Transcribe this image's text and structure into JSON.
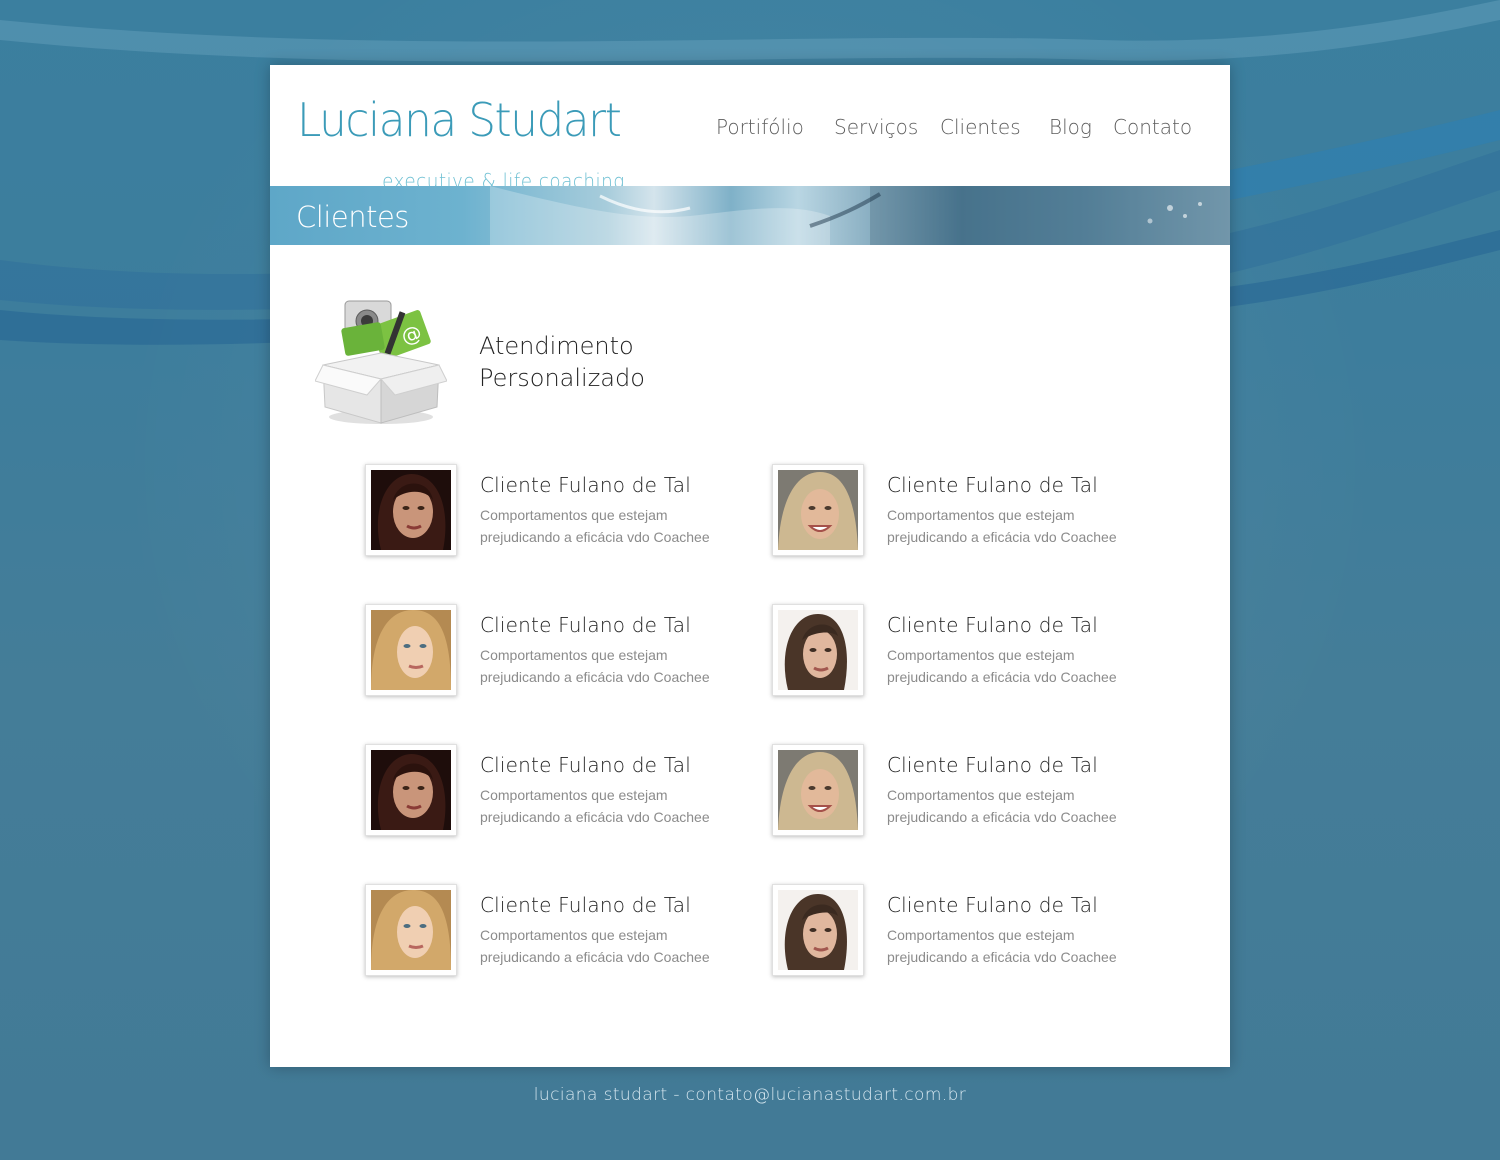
{
  "header": {
    "logo_name": "Luciana Studart",
    "logo_tagline": "executive & life coaching",
    "nav": [
      {
        "label": "Portifólio"
      },
      {
        "label": "Serviços"
      },
      {
        "label": "Clientes"
      },
      {
        "label": "Blog"
      },
      {
        "label": "Contato"
      }
    ]
  },
  "banner": {
    "title": "Clientes"
  },
  "feature": {
    "line1": "Atendimento",
    "line2": "Personalizado",
    "icon": "box-with-items-icon"
  },
  "clients": [
    {
      "name": "Cliente Fulano de Tal",
      "desc1": "Comportamentos que estejam",
      "desc2": "prejudicando a eficácia vdo Coachee"
    },
    {
      "name": "Cliente Fulano de Tal",
      "desc1": "Comportamentos que estejam",
      "desc2": "prejudicando a eficácia vdo Coachee"
    },
    {
      "name": "Cliente Fulano de Tal",
      "desc1": "Comportamentos que estejam",
      "desc2": "prejudicando a eficácia vdo Coachee"
    },
    {
      "name": "Cliente Fulano de Tal",
      "desc1": "Comportamentos que estejam",
      "desc2": "prejudicando a eficácia vdo Coachee"
    },
    {
      "name": "Cliente Fulano de Tal",
      "desc1": "Comportamentos que estejam",
      "desc2": "prejudicando a eficácia vdo Coachee"
    },
    {
      "name": "Cliente Fulano de Tal",
      "desc1": "Comportamentos que estejam",
      "desc2": "prejudicando a eficácia vdo Coachee"
    },
    {
      "name": "Cliente Fulano de Tal",
      "desc1": "Comportamentos que estejam",
      "desc2": "prejudicando a eficácia vdo Coachee"
    },
    {
      "name": "Cliente Fulano de Tal",
      "desc1": "Comportamentos que estejam",
      "desc2": "prejudicando a eficácia vdo Coachee"
    }
  ],
  "footer": {
    "text": "luciana studart - contato@lucianastudart.com.br"
  },
  "colors": {
    "accent": "#3b9bb8",
    "background": "#3f7a98"
  }
}
